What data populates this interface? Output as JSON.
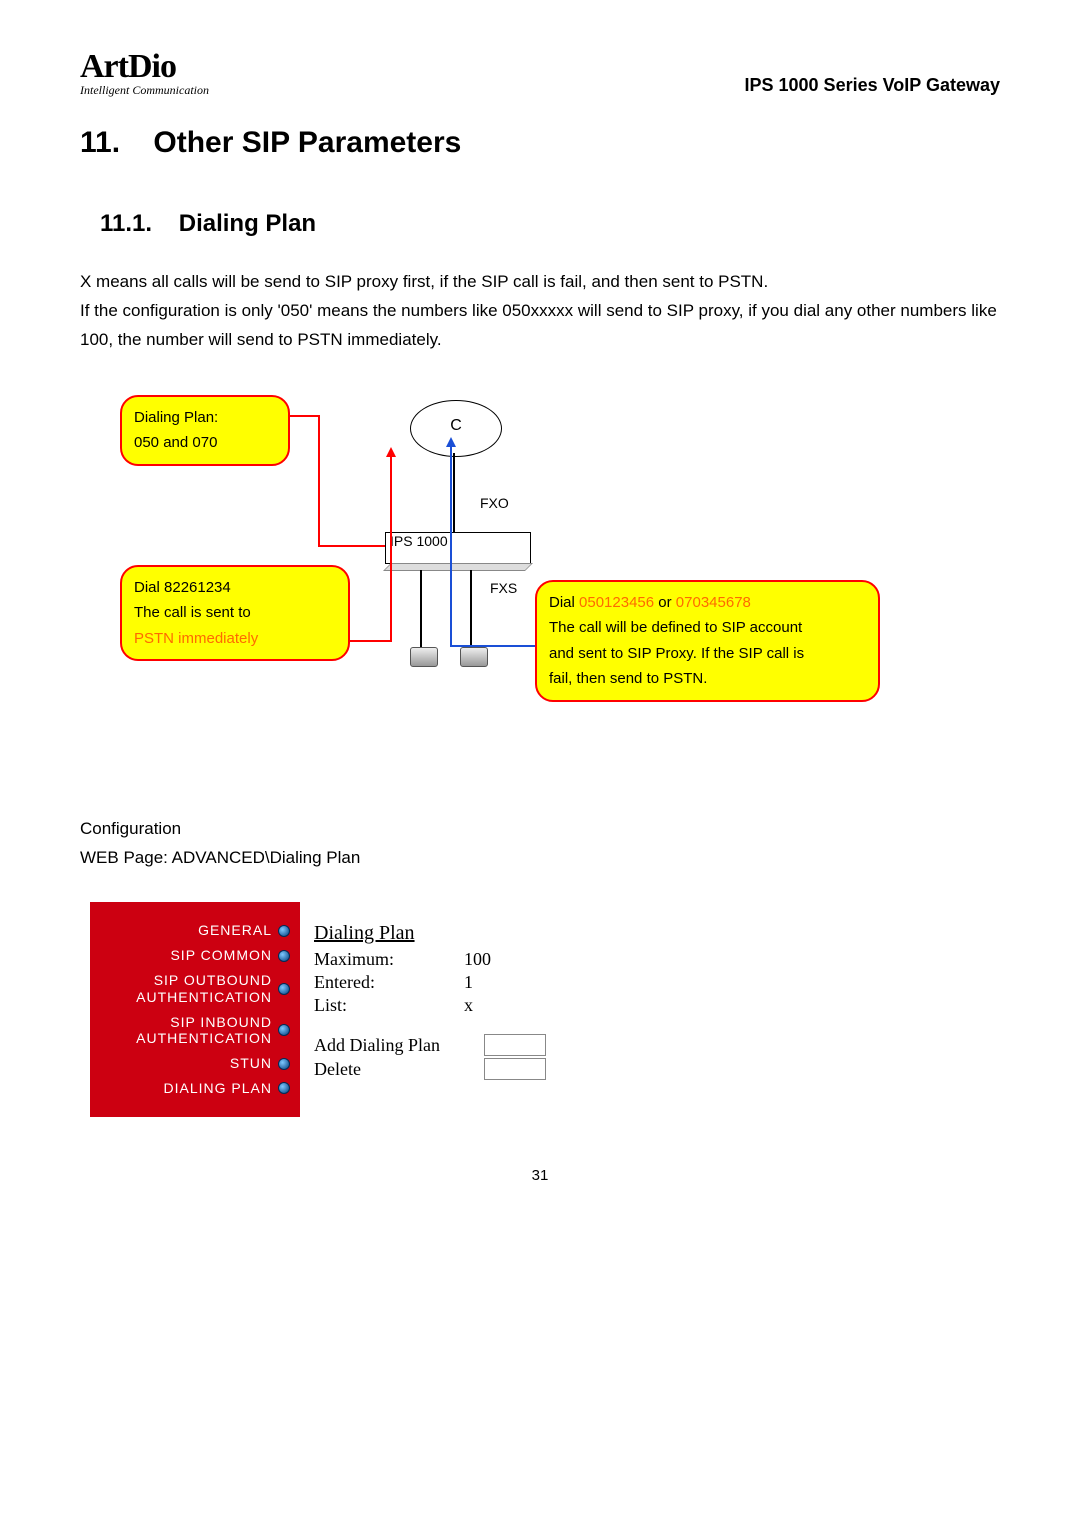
{
  "logo": {
    "main": "ArtDio",
    "sub": "Intelligent Communication"
  },
  "doc_title": "IPS 1000 Series VoIP Gateway",
  "h1_num": "11.",
  "h1_text": "Other SIP Parameters",
  "h2_num": "11.1.",
  "h2_text": "Dialing Plan",
  "para1": "X means all calls will be send to SIP proxy first, if the SIP call is fail, and then sent to PSTN.",
  "para2": "If the configuration is only '050' means the numbers like 050xxxxx will send to SIP proxy, if you dial any other numbers like 100, the number will send to PSTN immediately.",
  "diagram": {
    "callout_plan_l1": "Dialing Plan:",
    "callout_plan_l2": "050 and 070",
    "callout_pstn_l1": "Dial 82261234",
    "callout_pstn_l2": "The call is sent to",
    "callout_pstn_l3": "PSTN immediately",
    "callout_sip_l1a": "Dial ",
    "callout_sip_l1_num1": "050123456",
    "callout_sip_l1_mid": " or ",
    "callout_sip_l1_num2": "070345678",
    "callout_sip_l2": "The call will be defined to SIP account",
    "callout_sip_l3": "and sent to SIP Proxy. If the SIP call is",
    "callout_sip_l4": "fail, then send to PSTN.",
    "cloud_label": "C",
    "fxo_label": "FXO",
    "device_label": "IPS 1000",
    "fxs_label": "FXS"
  },
  "config_heading": "Configuration",
  "config_path": "WEB Page: ADVANCED\\Dialing Plan",
  "menu": {
    "general": "GENERAL",
    "sip_common": "SIP COMMON",
    "sip_outbound": "SIP OUTBOUND AUTHENTICATION",
    "sip_inbound": "SIP INBOUND AUTHENTICATION",
    "stun": "STUN",
    "dialing_plan": "DIALING PLAN"
  },
  "plan": {
    "title": "Dialing Plan",
    "max_k": "Maximum:",
    "max_v": "100",
    "entered_k": "Entered:",
    "entered_v": "1",
    "list_k": "List:",
    "list_v": "x",
    "add_label": "Add Dialing Plan",
    "delete_label": "Delete"
  },
  "page_number": "31"
}
